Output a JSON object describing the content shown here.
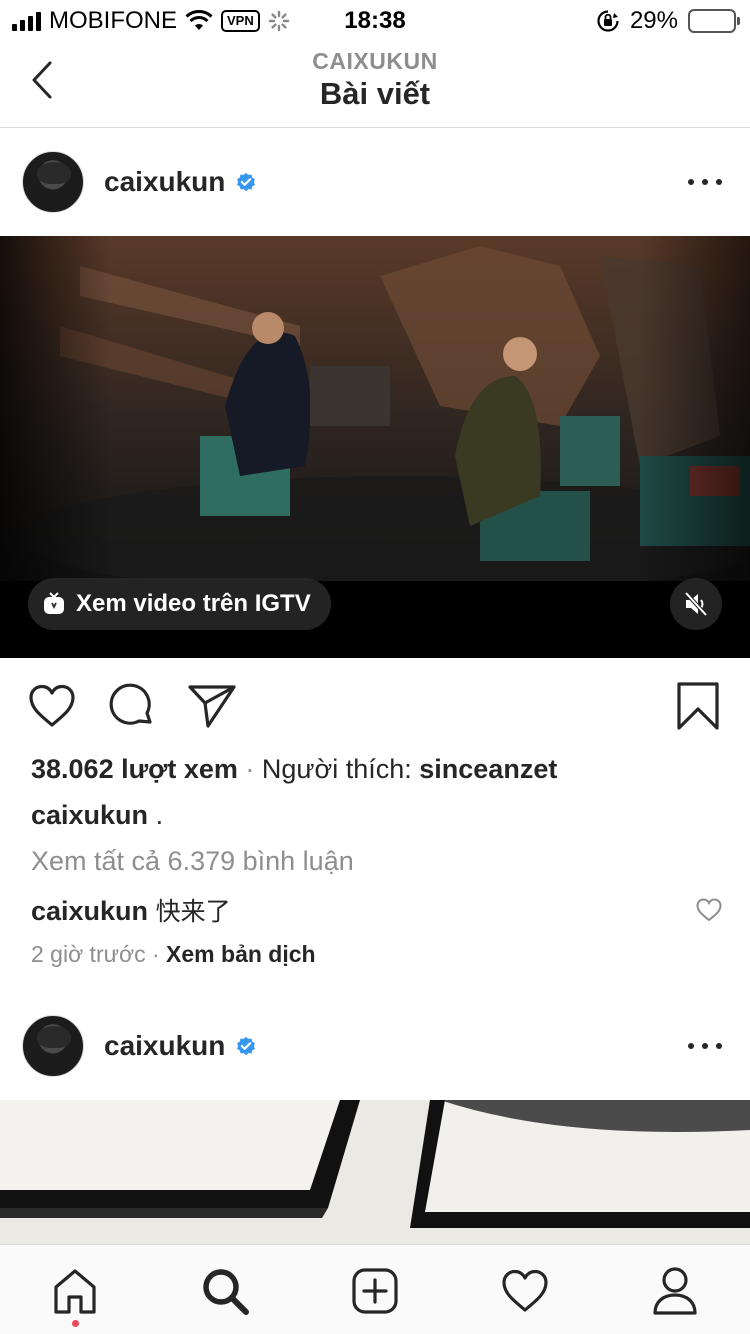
{
  "status_bar": {
    "carrier": "MOBIFONE",
    "vpn": "VPN",
    "time": "18:38",
    "battery": "29%",
    "battery_level": 0.29,
    "battery_color": "#f7c91c"
  },
  "nav": {
    "subtitle": "CAIXUKUN",
    "title": "Bài viết"
  },
  "posts": [
    {
      "username": "caixukun",
      "verified": true,
      "media": {
        "igtv_label": "Xem video trên IGTV",
        "muted": true
      },
      "views": "38.062 lượt xem",
      "separator": "·",
      "liked_by_prefix": "Người thích:",
      "liked_by": "sinceanzet",
      "caption_user": "caixukun",
      "caption": ".",
      "view_all_comments": "Xem tất cả 6.379 bình luận",
      "comment": {
        "user": "caixukun",
        "text": "快来了"
      },
      "time": "2 giờ trước",
      "translate": "Xem bản dịch"
    },
    {
      "username": "caixukun",
      "verified": true
    }
  ],
  "icons": {
    "back": "chevron-left-icon",
    "like": "heart-icon",
    "comment": "comment-icon",
    "share": "send-icon",
    "save": "bookmark-icon",
    "more": "ellipsis-icon",
    "mute": "speaker-muted-icon",
    "igtv": "igtv-icon"
  },
  "tab_bar": {
    "tabs": [
      "home",
      "search",
      "new-post",
      "activity",
      "profile"
    ],
    "active": "home",
    "notification_color": "#ed4956"
  },
  "colors": {
    "verified": "#3897f0",
    "text": "#262626",
    "secondary": "#8e8e8e"
  }
}
